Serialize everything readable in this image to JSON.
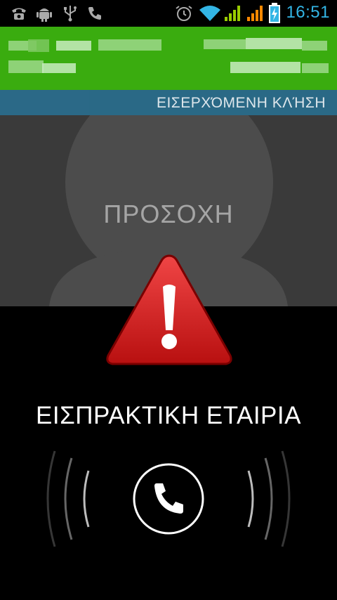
{
  "status_bar": {
    "time": "16:51",
    "icons": [
      "phone-notification-icon",
      "android-debug-icon",
      "usb-icon",
      "missed-call-icon",
      "alarm-icon",
      "wifi-icon",
      "signal-icon",
      "signal-roaming-icon",
      "battery-charging-icon"
    ],
    "colors": {
      "time": "#33b5e5",
      "signal": "#99cc00",
      "roaming": "#ff8800"
    }
  },
  "banner": {
    "color": "#3aac0f"
  },
  "call": {
    "state_label": "ΕΙΣΕΡΧΌΜΕΝΗ ΚΛΉΣΗ",
    "photo_text": "ΠΡΟΣΟΧΗ",
    "caller_name": "ΕΙΣΠΡΑΚΤΙΚΗ ΕΤΑΙΡΙΑ"
  },
  "controls": {
    "answer_icon": "phone-handset-icon"
  },
  "colors": {
    "callbar": "#2d6f8e",
    "warning": "#d32222"
  }
}
